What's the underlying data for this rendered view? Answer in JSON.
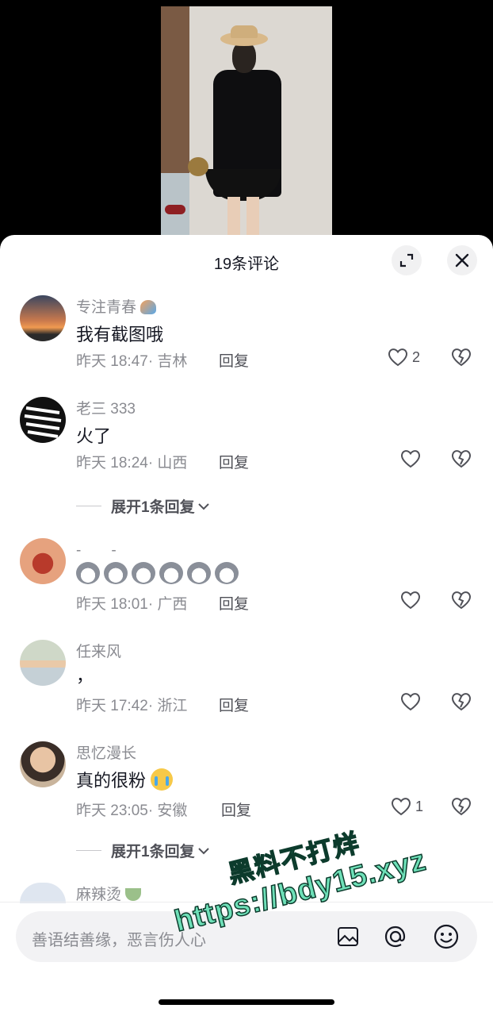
{
  "sheet": {
    "title": "19条评论"
  },
  "comments": [
    {
      "username": "专注青春",
      "text": "我有截图哦",
      "time": "昨天 18:47",
      "location": "· 吉林",
      "reply": "回复",
      "likes": "2"
    },
    {
      "username": "老三 333",
      "text": "火了",
      "time": "昨天 18:24",
      "location": "· 山西",
      "reply": "回复",
      "likes": "",
      "expand": "展开1条回复"
    },
    {
      "username": "-　　-",
      "text": "",
      "time": "昨天 18:01",
      "location": "· 广西",
      "reply": "回复",
      "likes": ""
    },
    {
      "username": "任来风",
      "text": "，",
      "time": "昨天 17:42",
      "location": "· 浙江",
      "reply": "回复",
      "likes": ""
    },
    {
      "username": "思忆漫长",
      "text": "真的很粉",
      "time": "昨天 23:05",
      "location": "· 安徽",
      "reply": "回复",
      "likes": "1",
      "expand": "展开1条回复"
    },
    {
      "username": "麻辣烫"
    }
  ],
  "input": {
    "placeholder": "善语结善缘，恶言伤人心"
  },
  "watermark": {
    "line1": "黑料不打烊",
    "line2": "https://bdy15.xyz"
  },
  "icons": {
    "close": "close-icon",
    "fullscreen": "fullscreen-icon",
    "like": "heart-icon",
    "dislike": "broken-heart-icon",
    "image": "image-icon",
    "mention": "at-icon",
    "emoji": "emoji-icon",
    "dog_emoji": "dog-emoji-icon",
    "crying_emoji": "crying-emoji-icon"
  },
  "colors": {
    "watermark": "#6ee0b8",
    "primary_text": "#161823",
    "secondary_text": "#8a8b91"
  }
}
